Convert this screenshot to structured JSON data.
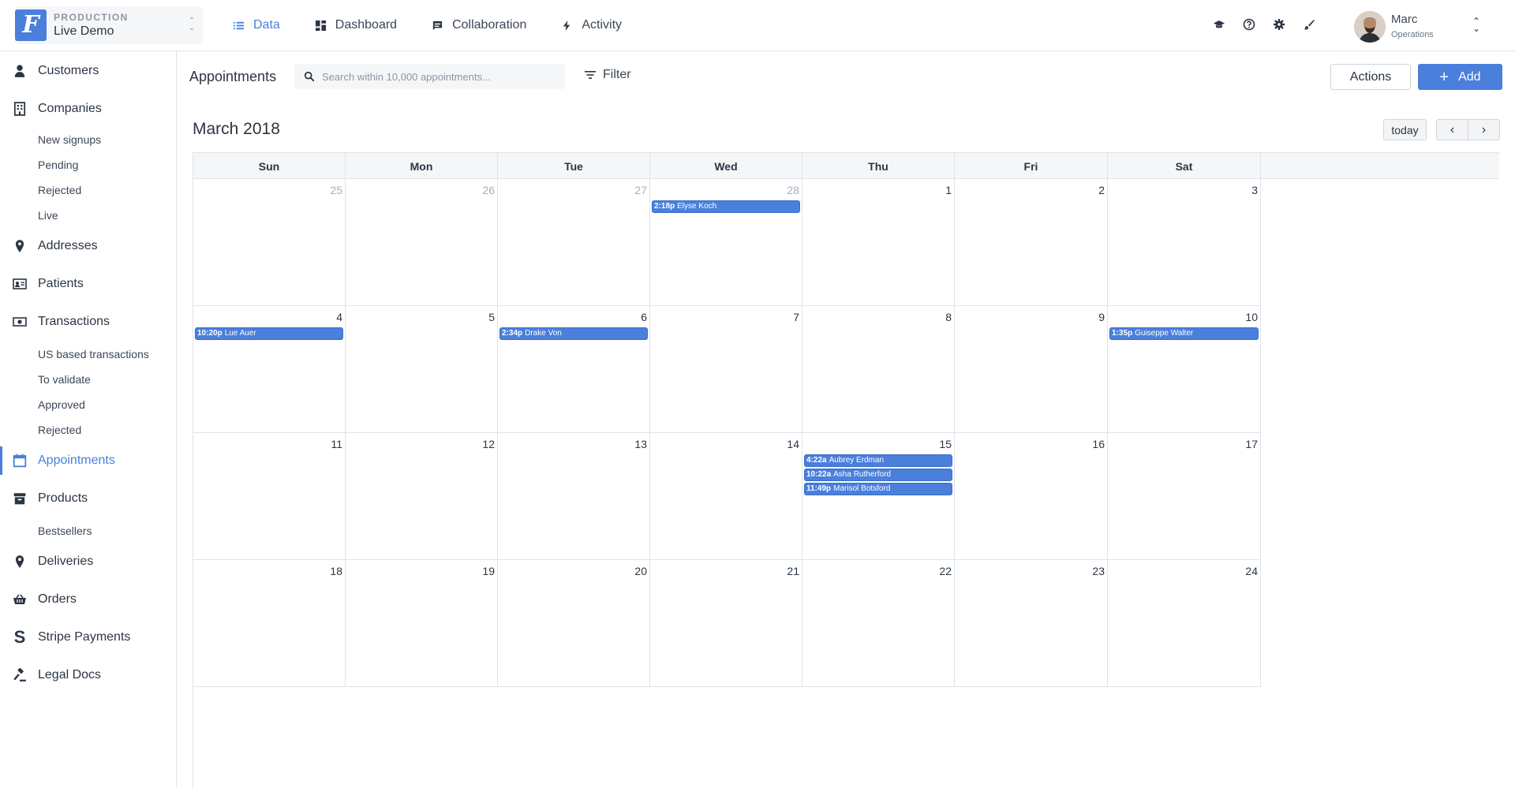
{
  "env": {
    "label": "PRODUCTION",
    "name": "Live Demo",
    "logo_letter": "F"
  },
  "topnav": [
    {
      "label": "Data",
      "icon": "list-icon",
      "active": true
    },
    {
      "label": "Dashboard",
      "icon": "dashboard-icon",
      "active": false
    },
    {
      "label": "Collaboration",
      "icon": "chat-icon",
      "active": false
    },
    {
      "label": "Activity",
      "icon": "bolt-icon",
      "active": false
    }
  ],
  "top_icons": [
    "graduation-cap-icon",
    "help-icon",
    "gear-icon",
    "brush-icon"
  ],
  "user": {
    "name": "Marc",
    "role": "Operations"
  },
  "sidebar": {
    "items": [
      {
        "label": "Customers",
        "icon": "person-icon"
      },
      {
        "label": "Companies",
        "icon": "building-icon"
      },
      {
        "label": "Addresses",
        "icon": "pin-icon"
      },
      {
        "label": "Patients",
        "icon": "id-card-icon"
      },
      {
        "label": "Transactions",
        "icon": "banknote-icon"
      },
      {
        "label": "Appointments",
        "icon": "calendar-icon"
      },
      {
        "label": "Products",
        "icon": "archive-icon"
      },
      {
        "label": "Deliveries",
        "icon": "pin-icon"
      },
      {
        "label": "Orders",
        "icon": "basket-icon"
      },
      {
        "label": "Stripe Payments",
        "icon": "stripe-icon"
      },
      {
        "label": "Legal Docs",
        "icon": "gavel-icon"
      }
    ],
    "companies_sub": [
      "New signups",
      "Pending",
      "Rejected",
      "Live"
    ],
    "transactions_sub": [
      "US based transactions",
      "To validate",
      "Approved",
      "Rejected"
    ],
    "products_sub": [
      "Bestsellers"
    ],
    "active": "Appointments"
  },
  "toolbar": {
    "title": "Appointments",
    "search_placeholder": "Search within 10,000 appointments...",
    "filter_label": "Filter",
    "actions_label": "Actions",
    "add_label": "Add"
  },
  "calendar": {
    "title": "March 2018",
    "today_label": "today",
    "prev_label": "‹",
    "next_label": "›",
    "weekdays": [
      "Sun",
      "Mon",
      "Tue",
      "Wed",
      "Thu",
      "Fri",
      "Sat"
    ],
    "weeks": [
      [
        {
          "day": "25",
          "other": true,
          "events": []
        },
        {
          "day": "26",
          "other": true,
          "events": []
        },
        {
          "day": "27",
          "other": true,
          "events": []
        },
        {
          "day": "28",
          "other": true,
          "events": [
            {
              "time": "2:18p",
              "name": "Elyse Koch"
            }
          ]
        },
        {
          "day": "1",
          "other": false,
          "events": []
        },
        {
          "day": "2",
          "other": false,
          "events": []
        },
        {
          "day": "3",
          "other": false,
          "events": []
        }
      ],
      [
        {
          "day": "4",
          "other": false,
          "events": [
            {
              "time": "10:20p",
              "name": "Lue Auer"
            }
          ]
        },
        {
          "day": "5",
          "other": false,
          "events": []
        },
        {
          "day": "6",
          "other": false,
          "events": [
            {
              "time": "2:34p",
              "name": "Drake Von"
            }
          ]
        },
        {
          "day": "7",
          "other": false,
          "events": []
        },
        {
          "day": "8",
          "other": false,
          "events": []
        },
        {
          "day": "9",
          "other": false,
          "events": []
        },
        {
          "day": "10",
          "other": false,
          "events": [
            {
              "time": "1:35p",
              "name": "Guiseppe Walter"
            }
          ]
        }
      ],
      [
        {
          "day": "11",
          "other": false,
          "events": []
        },
        {
          "day": "12",
          "other": false,
          "events": []
        },
        {
          "day": "13",
          "other": false,
          "events": []
        },
        {
          "day": "14",
          "other": false,
          "events": []
        },
        {
          "day": "15",
          "other": false,
          "events": [
            {
              "time": "4:22a",
              "name": "Aubrey Erdman"
            },
            {
              "time": "10:22a",
              "name": "Asha Rutherford"
            },
            {
              "time": "11:49p",
              "name": "Marisol Botsford"
            }
          ]
        },
        {
          "day": "16",
          "other": false,
          "events": []
        },
        {
          "day": "17",
          "other": false,
          "events": []
        }
      ],
      [
        {
          "day": "18",
          "other": false,
          "events": []
        },
        {
          "day": "19",
          "other": false,
          "events": []
        },
        {
          "day": "20",
          "other": false,
          "events": []
        },
        {
          "day": "21",
          "other": false,
          "events": []
        },
        {
          "day": "22",
          "other": false,
          "events": []
        },
        {
          "day": "23",
          "other": false,
          "events": []
        },
        {
          "day": "24",
          "other": false,
          "events": []
        }
      ]
    ]
  },
  "colors": {
    "accent": "#4a7fdc",
    "text": "#2b3543",
    "muted": "#a8b0ba",
    "border": "#dfe3e8"
  }
}
